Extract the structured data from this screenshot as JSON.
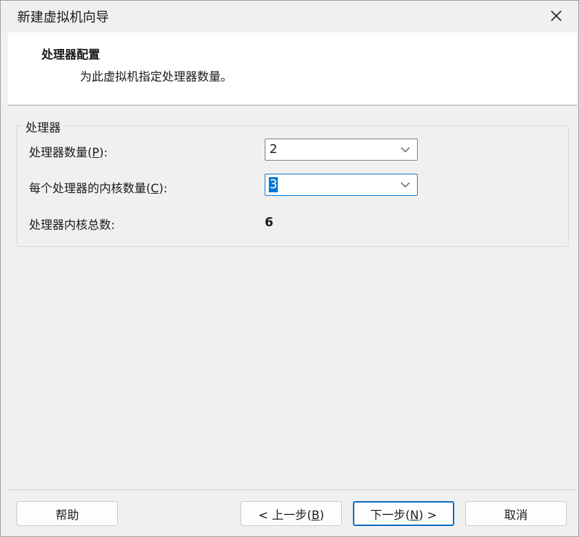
{
  "window": {
    "title": "新建虚拟机向导"
  },
  "header": {
    "title": "处理器配置",
    "subtitle": "为此虚拟机指定处理器数量。"
  },
  "processor_group": {
    "label": "处理器",
    "processor_count": {
      "label_prefix": "处理器数量(",
      "accel": "P",
      "label_suffix": "):",
      "value": "2"
    },
    "cores_per_processor": {
      "label_prefix": "每个处理器的内核数量(",
      "accel": "C",
      "label_suffix": "):",
      "value": "3"
    },
    "total_cores": {
      "label": "处理器内核总数:",
      "value": "6"
    }
  },
  "footer": {
    "help_label": "帮助",
    "back": {
      "prefix": "< 上一步(",
      "accel": "B",
      "suffix": ")"
    },
    "next": {
      "prefix": "下一步(",
      "accel": "N",
      "suffix": ") >"
    },
    "cancel_label": "取消"
  },
  "colors": {
    "accent": "#0078d7",
    "window_bg": "#f0f0f0",
    "header_bg": "#ffffff"
  },
  "icons": {
    "close": "close-icon",
    "dropdown": "chevron-down-icon"
  }
}
